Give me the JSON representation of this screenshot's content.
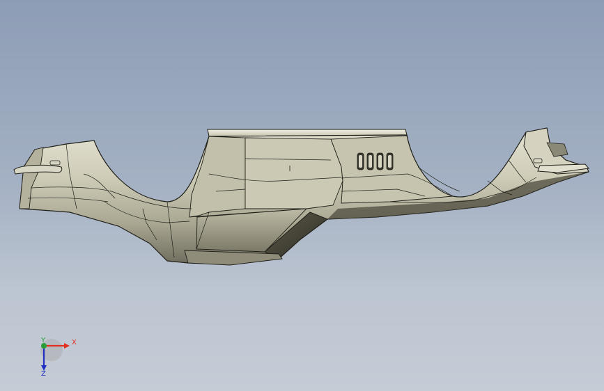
{
  "viewport": {
    "background_top": "#8d9db5",
    "background_bottom": "#c6ccd6",
    "model_color": "#c9c7b2"
  },
  "triad": {
    "x_label": "X",
    "y_label": "Y",
    "z_label": "Z",
    "x_color": "#e03020",
    "y_color": "#2a9d3a",
    "z_color": "#2030c0"
  }
}
